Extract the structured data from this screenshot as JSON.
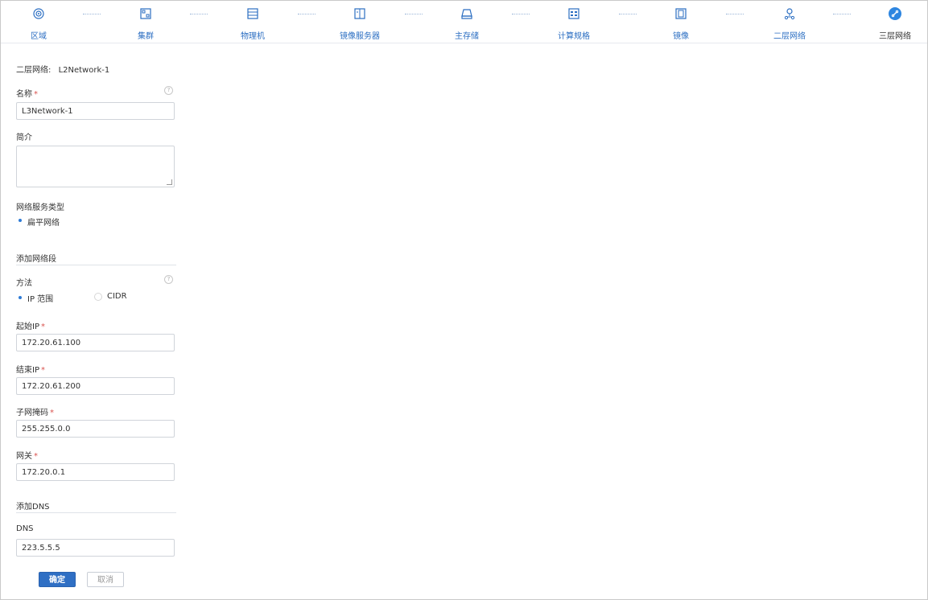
{
  "steps": [
    {
      "label": "区域",
      "icon": "zone-icon",
      "active": false
    },
    {
      "label": "集群",
      "icon": "cluster-icon",
      "active": false
    },
    {
      "label": "物理机",
      "icon": "host-icon",
      "active": false
    },
    {
      "label": "镜像服务器",
      "icon": "backup-storage-icon",
      "active": false
    },
    {
      "label": "主存储",
      "icon": "primary-storage-icon",
      "active": false
    },
    {
      "label": "计算规格",
      "icon": "instance-offering-icon",
      "active": false
    },
    {
      "label": "镜像",
      "icon": "image-icon",
      "active": false
    },
    {
      "label": "二层网络",
      "icon": "l2-network-icon",
      "active": false
    },
    {
      "label": "三层网络",
      "icon": "l3-network-icon",
      "active": true
    }
  ],
  "colors": {
    "accent": "#2f6fc4",
    "step_blue": "#2b6ec2",
    "required": "#d9534f"
  },
  "form": {
    "l2_label": "二层网络:",
    "l2_value": "L2Network-1",
    "name_label": "名称",
    "required_mark": "*",
    "name_value": "L3Network-1",
    "desc_label": "简介",
    "desc_value": "",
    "service_type_label": "网络服务类型",
    "service_type_option": "扁平网络",
    "add_range_section": "添加网络段",
    "method_label": "方法",
    "method_options": [
      "IP 范围",
      "CIDR"
    ],
    "method_selected": "IP 范围",
    "start_ip_label": "起始IP",
    "start_ip_value": "172.20.61.100",
    "end_ip_label": "结束IP",
    "end_ip_value": "172.20.61.200",
    "netmask_label": "子网掩码",
    "netmask_value": "255.255.0.0",
    "gateway_label": "网关",
    "gateway_value": "172.20.0.1",
    "add_dns_section": "添加DNS",
    "dns_label": "DNS",
    "dns_value": "223.5.5.5",
    "help_glyph": "?",
    "ok_button": "确定",
    "cancel_button": "取消"
  }
}
